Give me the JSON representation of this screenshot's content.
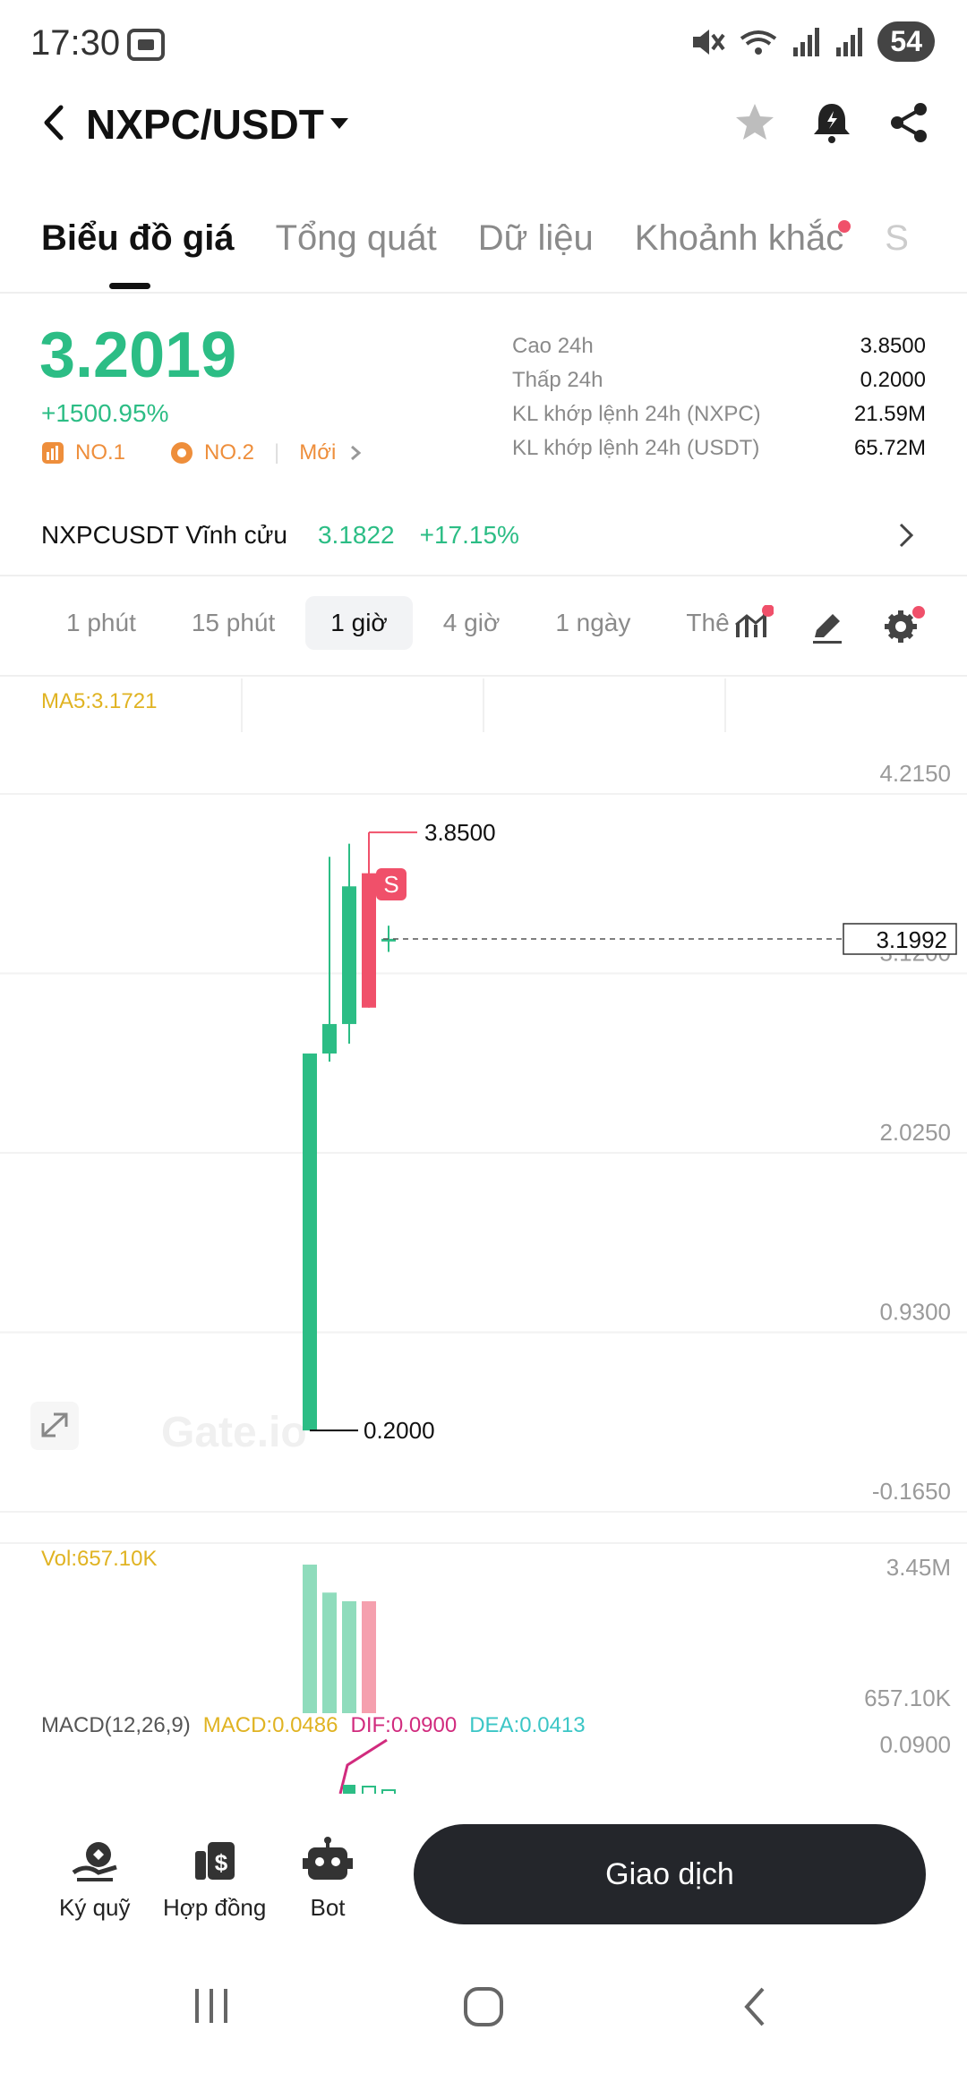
{
  "status_bar": {
    "time": "17:30",
    "battery": "54"
  },
  "header": {
    "title": "NXPC/USDT"
  },
  "tabs": [
    {
      "label": "Biểu đồ giá",
      "active": true
    },
    {
      "label": "Tổng quát"
    },
    {
      "label": "Dữ liệu"
    },
    {
      "label": "Khoảnh khắc",
      "has_dot": true
    },
    {
      "label": "S"
    }
  ],
  "ticker": {
    "price": "3.2019",
    "change": "+1500.95%",
    "rank1": "NO.1",
    "rank2": "NO.2",
    "new_label": "Mới",
    "stats": [
      {
        "key": "Cao 24h",
        "value": "3.8500"
      },
      {
        "key": "Thấp 24h",
        "value": "0.2000"
      },
      {
        "key": "KL khớp lệnh 24h (NXPC)",
        "value": "21.59M"
      },
      {
        "key": "KL khớp lệnh 24h (USDT)",
        "value": "65.72M"
      }
    ]
  },
  "perpetual": {
    "label": "NXPCUSDT Vĩnh cửu",
    "price": "3.1822",
    "change": "+17.15%"
  },
  "intervals": [
    {
      "label": "1 phút"
    },
    {
      "label": "15 phút"
    },
    {
      "label": "1 giờ",
      "active": true
    },
    {
      "label": "4 giờ"
    },
    {
      "label": "1 ngày"
    },
    {
      "label": "Thê"
    }
  ],
  "chart": {
    "ma_label": "MA5:3.1721",
    "vol_label": "Vol:657.10K",
    "macd": {
      "name": "MACD(12,26,9)",
      "macd": "MACD:0.0486",
      "dif": "DIF:0.0900",
      "dea": "DEA:0.0413"
    },
    "watermark": "Gate.io",
    "colors": {
      "up": "#2cbd85",
      "down": "#f0506a",
      "ma": "#e0b322",
      "dif": "#d12b7e",
      "dea": "#3bc6c6"
    }
  },
  "chart_data": {
    "type": "candlestick",
    "price_axis_ticks": [
      "4.2150",
      "3.1200",
      "2.0250",
      "0.9300",
      "-0.1650"
    ],
    "ylim": [
      -0.165,
      4.215
    ],
    "high_label": "3.8500",
    "low_label": "0.2000",
    "current_price_label": "3.1992",
    "candles": [
      {
        "open": 0.2,
        "close": 2.5,
        "high": 2.5,
        "low": 0.2,
        "dir": "up"
      },
      {
        "open": 2.5,
        "close": 2.68,
        "high": 3.7,
        "low": 2.45,
        "dir": "up"
      },
      {
        "open": 2.68,
        "close": 3.52,
        "high": 3.78,
        "low": 2.56,
        "dir": "up"
      },
      {
        "open": 3.6,
        "close": 2.78,
        "high": 3.85,
        "low": 2.78,
        "dir": "down"
      },
      {
        "open": 3.2,
        "close": 3.2,
        "high": 3.28,
        "low": 3.12,
        "dir": "up"
      }
    ],
    "volume_axis_ticks": [
      "3.45M",
      "657.10K"
    ],
    "volumes": [
      3.45,
      2.8,
      2.6,
      2.6
    ],
    "volume_dirs": [
      "up",
      "up",
      "up",
      "down"
    ],
    "macd_axis_ticks": [
      "0.0900"
    ]
  },
  "bottom": {
    "margin": "Ký quỹ",
    "futures": "Hợp đồng",
    "bot": "Bot",
    "trade": "Giao dịch"
  }
}
